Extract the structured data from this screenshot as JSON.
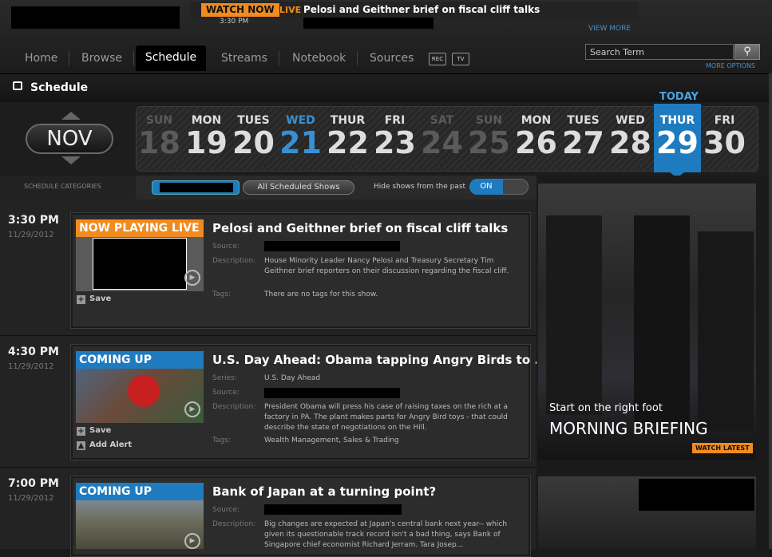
{
  "ticker": {
    "watch_now": "WATCH NOW",
    "live": "LIVE",
    "headline": "Pelosi and Geithner brief on fiscal cliff talks",
    "time": "3:30 PM",
    "view_more": "VIEW MORE"
  },
  "nav": {
    "items": [
      {
        "label": "Home"
      },
      {
        "label": "Browse"
      },
      {
        "label": "Schedule"
      },
      {
        "label": "Streams"
      },
      {
        "label": "Notebook"
      },
      {
        "label": "Sources"
      }
    ],
    "rec_icon": "REC",
    "tv_icon": "TV"
  },
  "search": {
    "placeholder": "Search Term",
    "more_options": "MORE OPTIONS"
  },
  "schedule": {
    "title": "Schedule",
    "month": "NOV",
    "today_label": "TODAY",
    "days": [
      {
        "name": "SUN",
        "num": "18"
      },
      {
        "name": "MON",
        "num": "19"
      },
      {
        "name": "TUES",
        "num": "20"
      },
      {
        "name": "WED",
        "num": "21"
      },
      {
        "name": "THUR",
        "num": "22"
      },
      {
        "name": "FRI",
        "num": "23"
      },
      {
        "name": "SAT",
        "num": "24"
      },
      {
        "name": "SUN",
        "num": "25"
      },
      {
        "name": "MON",
        "num": "26"
      },
      {
        "name": "TUES",
        "num": "27"
      },
      {
        "name": "WED",
        "num": "28"
      },
      {
        "name": "THUR",
        "num": "29"
      },
      {
        "name": "FRI",
        "num": "30"
      }
    ],
    "categories_label": "SCHEDULE CATEGORIES",
    "all_shows": "All Scheduled Shows",
    "hide_past": "Hide shows from the past",
    "toggle": "ON"
  },
  "shows": [
    {
      "time": "3:30 PM",
      "date": "11/29/2012",
      "badge": "NOW PLAYING LIVE",
      "title": "Pelosi and Geithner brief on fiscal cliff talks",
      "source_label": "Source:",
      "description_label": "Description:",
      "description": "House Minority Leader Nancy Pelosi and Treasury Secretary Tim Geithner brief reporters on their discussion regarding the fiscal cliff.",
      "tags_label": "Tags:",
      "tags": "There are no tags for this show.",
      "save": "Save"
    },
    {
      "time": "4:30 PM",
      "date": "11/29/2012",
      "badge": "COMING UP",
      "title": "U.S. Day Ahead: Obama tapping Angry Birds to ...",
      "series_label": "Series:",
      "series": "U.S. Day Ahead",
      "source_label": "Source:",
      "description_label": "Description:",
      "description": "President Obama will press his case of raising taxes on the rich at a factory in PA. The plant makes parts for Angry Bird toys - that could describe the state of negotiations on the Hill.",
      "tags_label": "Tags:",
      "tags": "Wealth Management, Sales & Trading",
      "save": "Save",
      "alert": "Add Alert"
    },
    {
      "time": "7:00 PM",
      "date": "11/29/2012",
      "badge": "COMING UP",
      "title": "Bank of Japan at a turning point?",
      "source_label": "Source:",
      "description_label": "Description:",
      "description": "Big changes are expected at Japan's central bank next year-- which given its questionable track record isn't a bad thing, says Bank of Singapore chief economist Richard Jerram. Tara Josep..."
    }
  ],
  "promo": {
    "subtitle": "Start on the right foot",
    "title": "MORNING BRIEFING",
    "button": "WATCH LATEST"
  },
  "colors": {
    "accent_orange": "#f08b1f",
    "accent_blue": "#1e7bc0",
    "link_blue": "#4a90c8"
  }
}
